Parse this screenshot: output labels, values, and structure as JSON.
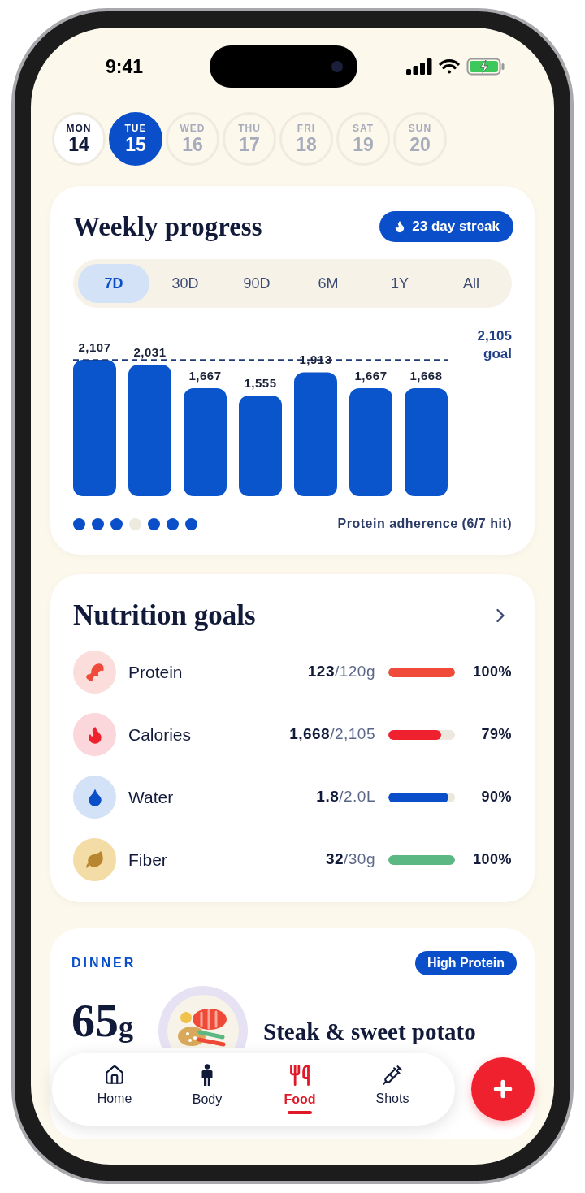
{
  "status_bar": {
    "time": "9:41"
  },
  "days": [
    {
      "weekday": "MON",
      "date": "14",
      "selected": false,
      "past": true
    },
    {
      "weekday": "TUE",
      "date": "15",
      "selected": true,
      "past": true
    },
    {
      "weekday": "WED",
      "date": "16",
      "selected": false,
      "past": false
    },
    {
      "weekday": "THU",
      "date": "17",
      "selected": false,
      "past": false
    },
    {
      "weekday": "FRI",
      "date": "18",
      "selected": false,
      "past": false
    },
    {
      "weekday": "SAT",
      "date": "19",
      "selected": false,
      "past": false
    },
    {
      "weekday": "SUN",
      "date": "20",
      "selected": false,
      "past": false
    }
  ],
  "weekly_progress": {
    "title": "Weekly progress",
    "streak": "23 day streak",
    "ranges": [
      {
        "label": "7D",
        "selected": true
      },
      {
        "label": "30D",
        "selected": false
      },
      {
        "label": "90D",
        "selected": false
      },
      {
        "label": "6M",
        "selected": false
      },
      {
        "label": "1Y",
        "selected": false
      },
      {
        "label": "All",
        "selected": false
      }
    ],
    "bar_labels": [
      "2,107",
      "2,031",
      "1,667",
      "1,555",
      "1,913",
      "1,667",
      "1,668"
    ],
    "goal_label": "2,105 goal",
    "adherence": [
      {
        "hit": true
      },
      {
        "hit": true
      },
      {
        "hit": true
      },
      {
        "hit": false
      },
      {
        "hit": true
      },
      {
        "hit": true
      },
      {
        "hit": true
      }
    ],
    "adherence_label": "Protein adherence (6/7 hit)"
  },
  "nutrition_goals": {
    "title": "Nutrition goals",
    "items": [
      {
        "kind": "protein",
        "name": "Protein",
        "amount": "123",
        "target": "/120g",
        "level": 1,
        "percent": "100%",
        "color": "#f04a3a"
      },
      {
        "kind": "calories",
        "name": "Calories",
        "amount": "1,668",
        "target": "/2,105",
        "level": 0.79,
        "percent": "79%",
        "color": "#f0212e"
      },
      {
        "kind": "water",
        "name": "Water",
        "amount": "1.8",
        "target": "/2.0L",
        "level": 0.9,
        "percent": "90%",
        "color": "#0a4fc9"
      },
      {
        "kind": "fiber",
        "name": "Fiber",
        "amount": "32",
        "target": "/30g",
        "level": 1,
        "percent": "100%",
        "color": "#5bb883"
      }
    ]
  },
  "meal": {
    "label": "DINNER",
    "tag": "High Protein",
    "amount": "65",
    "unit": "g",
    "name": "Steak & sweet potato"
  },
  "nav": [
    {
      "kind": "home",
      "label": "Home",
      "selected": false
    },
    {
      "kind": "body",
      "label": "Body",
      "selected": false
    },
    {
      "kind": "food",
      "label": "Food",
      "selected": true
    },
    {
      "kind": "shots",
      "label": "Shots",
      "selected": false
    }
  ]
}
